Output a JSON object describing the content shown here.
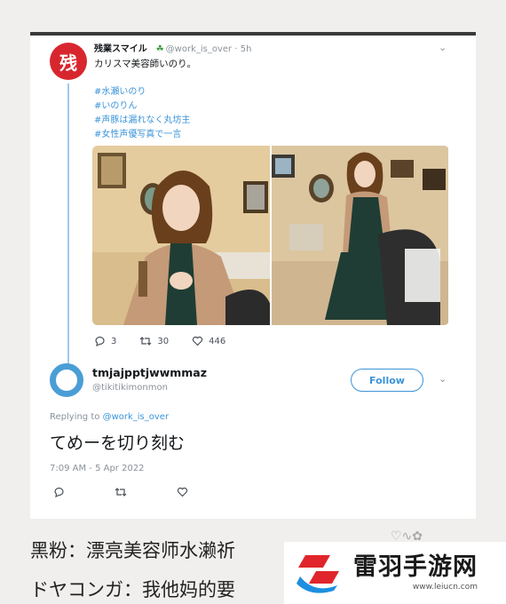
{
  "tweet1": {
    "avatar_char": "残",
    "name": "残業スマイル",
    "handle": "@work_is_over",
    "time": "5h",
    "text": "カリスマ美容師いのり。",
    "hashtags": [
      "#水瀬いのり",
      "#いのりん",
      "#声豚は漏れなく丸坊主",
      "#女性声優写真で一言"
    ],
    "replies": "3",
    "retweets": "30",
    "likes": "446"
  },
  "tweet2": {
    "name": "tmjajpptjwwmmaz",
    "handle": "@tikitikimonmon",
    "follow_label": "Follow",
    "replying_prefix": "Replying to",
    "replying_handle": "@work_is_over",
    "text": "てめーを切り刻む",
    "timestamp": "7:09 AM - 5 Apr 2022"
  },
  "caption": {
    "line1": "黑粉：漂亮美容师水濑祈",
    "line2": "ドヤコンガ：我他妈的要"
  },
  "watermark": {
    "title": "雷羽手游网",
    "url": "www.leiucn.com"
  },
  "colors": {
    "link": "#3b94d9",
    "muted": "#8a9199",
    "avatar_red": "#d8262e",
    "thread_line": "#9fc9ee",
    "logo_red": "#e0262c",
    "logo_blue": "#1d8fe0"
  }
}
